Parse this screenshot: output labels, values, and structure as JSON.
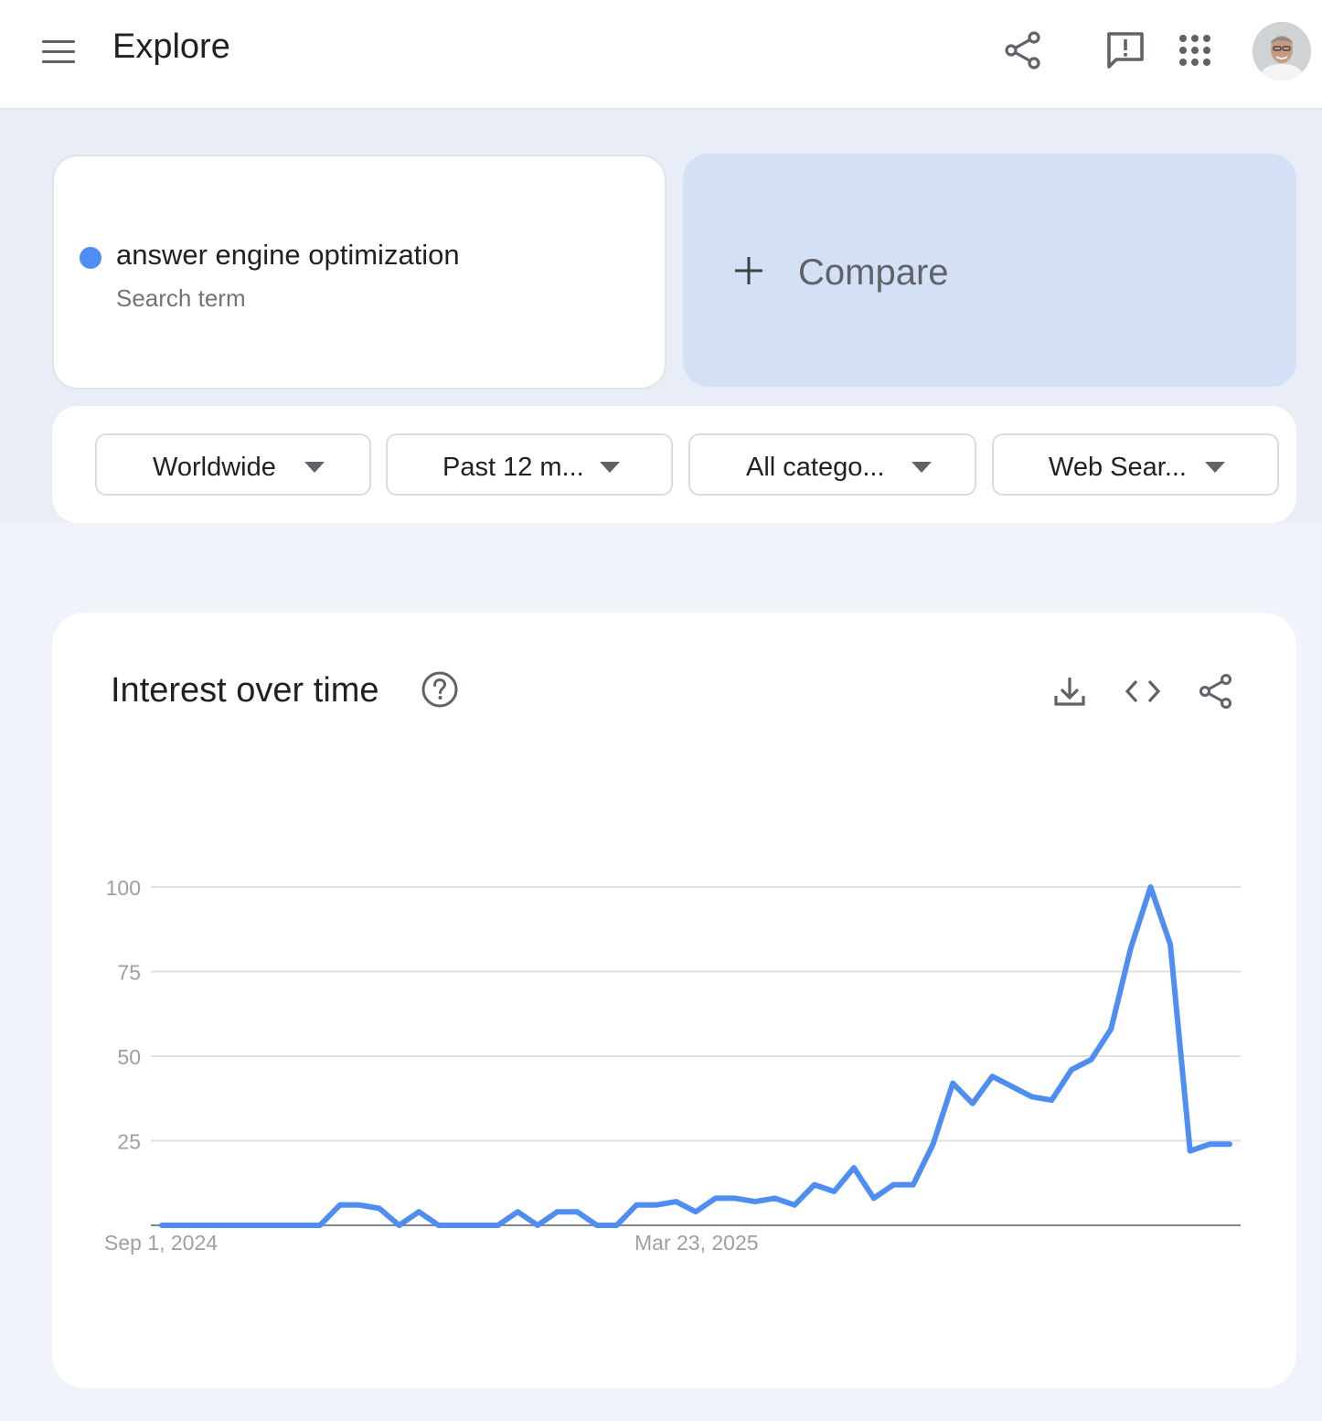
{
  "header": {
    "title": "Explore",
    "icons": [
      "menu-icon",
      "share-icon",
      "feedback-icon",
      "apps-grid-icon",
      "avatar"
    ]
  },
  "search": {
    "term": "answer engine optimization",
    "term_type": "Search term",
    "term_color": "#4e8ef2",
    "compare_label": "Compare"
  },
  "filters": {
    "region": "Worldwide",
    "time": "Past 12 m...",
    "category": "All catego...",
    "property": "Web Sear..."
  },
  "chart_card": {
    "title": "Interest over time",
    "icons": [
      "help-icon",
      "download-icon",
      "embed-code-icon",
      "share-icon"
    ]
  },
  "chart_data": {
    "type": "line",
    "title": "Interest over time",
    "xlabel": "",
    "ylabel": "",
    "x_tick_labels": [
      "Sep 1, 2024",
      "Mar 23, 2025"
    ],
    "y_ticks": [
      25,
      50,
      75,
      100
    ],
    "ylim": [
      0,
      100
    ],
    "grid": true,
    "series": [
      {
        "color": "#4e8ef2",
        "values": [
          0,
          0,
          0,
          0,
          0,
          0,
          0,
          0,
          0,
          6,
          6,
          5,
          0,
          4,
          0,
          0,
          0,
          0,
          4,
          0,
          4,
          4,
          0,
          0,
          6,
          6,
          7,
          4,
          8,
          8,
          7,
          8,
          6,
          12,
          10,
          17,
          8,
          12,
          12,
          24,
          42,
          36,
          44,
          41,
          38,
          37,
          46,
          49,
          58,
          82,
          100,
          83,
          22,
          24,
          24
        ]
      }
    ]
  }
}
